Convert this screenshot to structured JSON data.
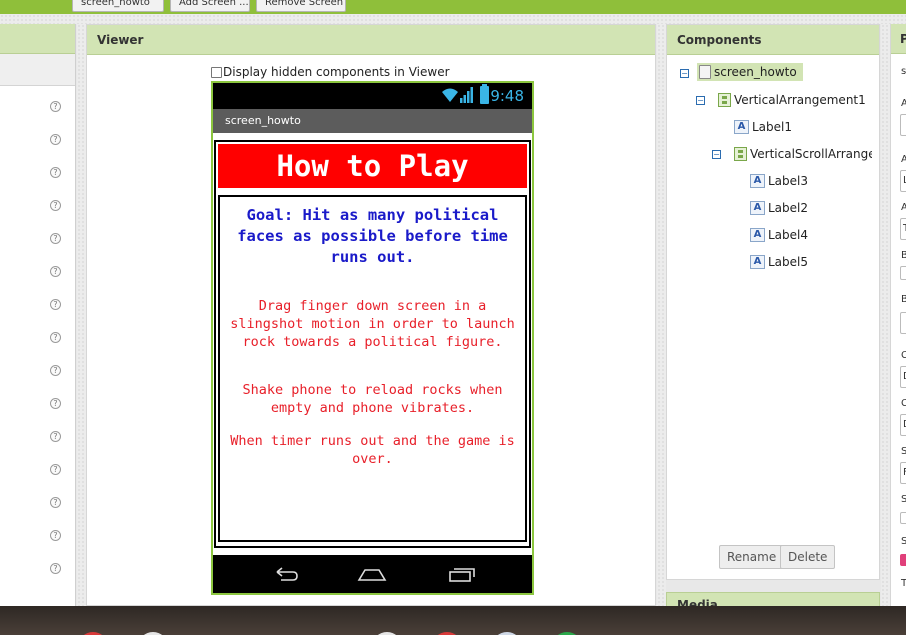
{
  "toolbar": {
    "buttons": [
      "screen_howto",
      "Add Screen ...",
      "Remove Screen"
    ]
  },
  "viewer": {
    "title": "Viewer",
    "hidden_components_label": "Display hidden components in Viewer"
  },
  "phone": {
    "time": "9:48",
    "screen_title": "screen_howto",
    "heading": "How to Play",
    "goal_text": "Goal: Hit as many political faces as possible before time runs out.",
    "instructions": [
      "Drag finger down screen in a slingshot motion in order to launch rock towards a political figure.",
      "Shake phone to reload rocks when empty and phone vibrates.",
      "When timer runs out and the game is over."
    ]
  },
  "components": {
    "title": "Components",
    "tree": [
      {
        "label": "screen_howto",
        "type": "screen"
      },
      {
        "label": "VerticalArrangement1",
        "type": "arrangement"
      },
      {
        "label": "Label1",
        "type": "label"
      },
      {
        "label": "VerticalScrollArrangem",
        "type": "arrangement"
      },
      {
        "label": "Label3",
        "type": "label"
      },
      {
        "label": "Label2",
        "type": "label"
      },
      {
        "label": "Label4",
        "type": "label"
      },
      {
        "label": "Label5",
        "type": "label"
      }
    ],
    "rename_label": "Rename",
    "delete_label": "Delete"
  },
  "media": {
    "title": "Media"
  },
  "properties": {
    "title": "P",
    "sub": "s",
    "letters": [
      "A",
      "A",
      "A",
      "B",
      "B",
      "C",
      "C",
      "S",
      "S",
      "S",
      "T"
    ],
    "box_values": [
      "L",
      "T",
      "D",
      "D",
      "F"
    ]
  },
  "colors": {
    "header_green": "#d2e4b4",
    "toolbar_green": "#8fbf3a",
    "phone_border": "#8cc63f",
    "heading_bg": "#ff0000",
    "goal_text": "#1a1ac9",
    "instruction_text": "#e8202a",
    "status_blue": "#3ab5e6"
  }
}
